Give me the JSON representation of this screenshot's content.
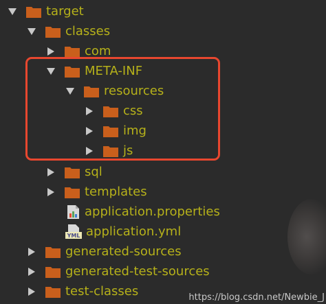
{
  "tree": {
    "items": [
      {
        "label": "target",
        "expanded": true,
        "kind": "folder"
      },
      {
        "label": "classes",
        "expanded": true,
        "kind": "folder"
      },
      {
        "label": "com",
        "expanded": false,
        "kind": "folder"
      },
      {
        "label": "META-INF",
        "expanded": true,
        "kind": "folder"
      },
      {
        "label": "resources",
        "expanded": true,
        "kind": "folder"
      },
      {
        "label": "css",
        "expanded": false,
        "kind": "folder"
      },
      {
        "label": "img",
        "expanded": false,
        "kind": "folder"
      },
      {
        "label": "js",
        "expanded": false,
        "kind": "folder"
      },
      {
        "label": "sql",
        "expanded": false,
        "kind": "folder"
      },
      {
        "label": "templates",
        "expanded": false,
        "kind": "folder"
      },
      {
        "label": "application.properties",
        "kind": "properties-file"
      },
      {
        "label": "application.yml",
        "kind": "yml-file"
      },
      {
        "label": "generated-sources",
        "expanded": false,
        "kind": "folder"
      },
      {
        "label": "generated-test-sources",
        "expanded": false,
        "kind": "folder"
      },
      {
        "label": "test-classes",
        "expanded": false,
        "kind": "folder"
      }
    ],
    "yml_icon_text": "YML"
  },
  "watermark": "https://blog.csdn.net/Newbie_J",
  "colors": {
    "background": "#2b2b2b",
    "label": "#b6b11a",
    "folder": "#c95f1c",
    "arrow": "#c8c8c8",
    "highlight": "#e8472f"
  }
}
